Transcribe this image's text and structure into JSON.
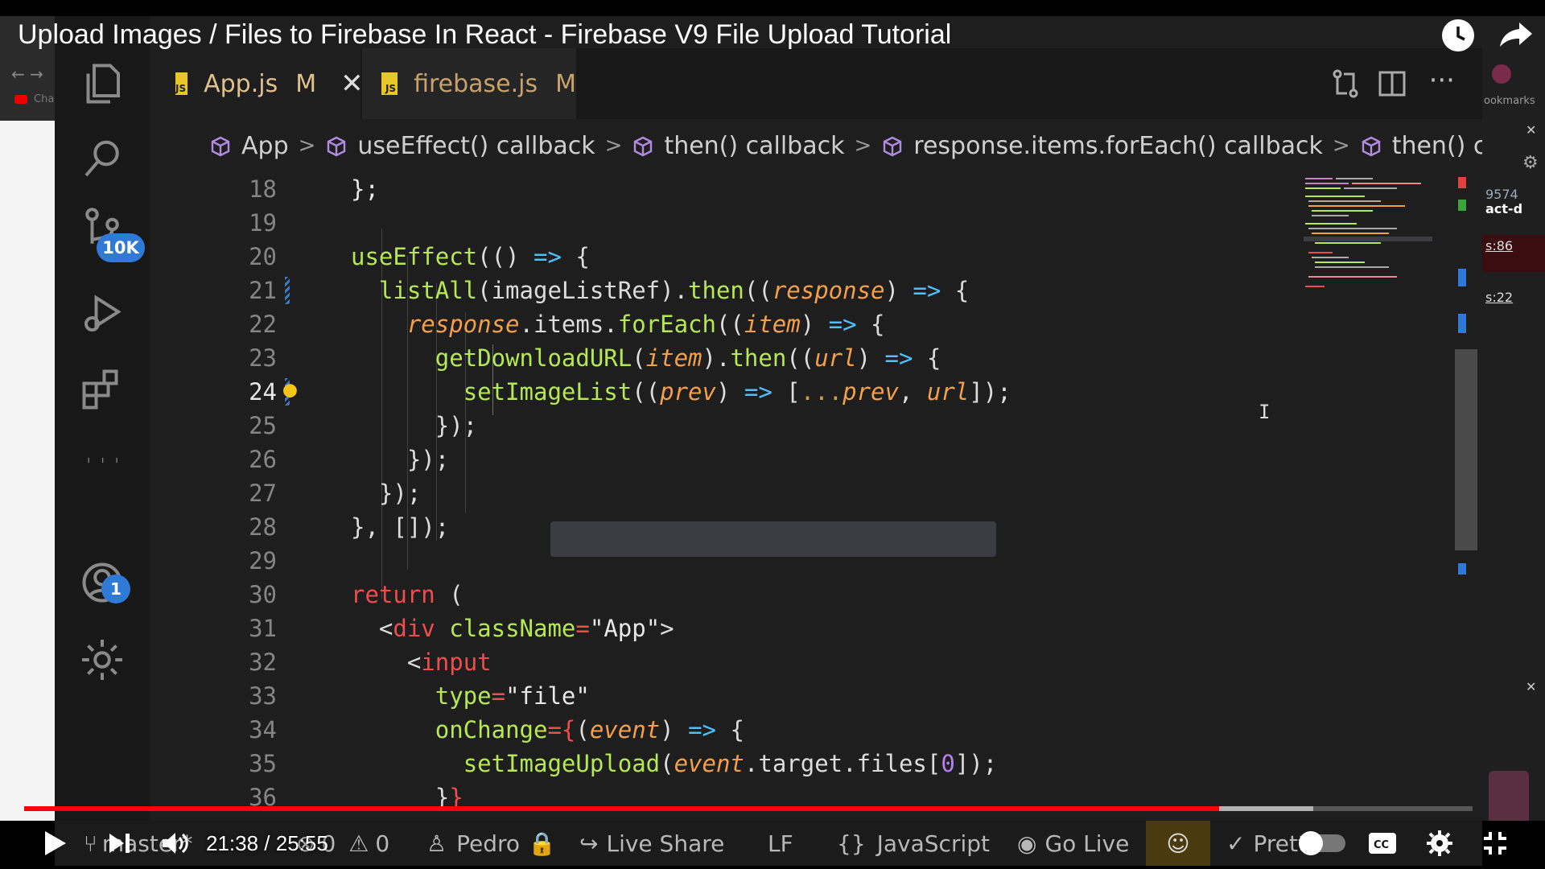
{
  "video": {
    "title": "Upload Images / Files to Firebase In React - Firebase V9 File Upload Tutorial",
    "time_current": "21:38",
    "time_total": "25:55",
    "time_display": "21:38 / 25:55",
    "progress_fraction": 0.825,
    "buffered_fraction": 0.89
  },
  "browser": {
    "tab_text": "Cha",
    "bookmarks_text": "ookmarks"
  },
  "activity_bar": {
    "source_control_badge": "10K",
    "accounts_badge": "1"
  },
  "tabs": [
    {
      "icon": "JS",
      "label": "App.js",
      "status": "M",
      "active": true
    },
    {
      "icon": "JS",
      "label": "firebase.js",
      "status": "M",
      "active": false
    }
  ],
  "breadcrumbs": [
    "App",
    "useEffect() callback",
    "then() callback",
    "response.items.forEach() callback",
    "then() callback"
  ],
  "editor": {
    "active_line": 24,
    "line_numbers": [
      "18",
      "19",
      "20",
      "21",
      "22",
      "23",
      "24",
      "25",
      "26",
      "27",
      "28",
      "29",
      "30",
      "31",
      "32",
      "33",
      "34",
      "35",
      "36"
    ]
  },
  "right_panel": {
    "texts": [
      "9574",
      "act-d",
      "s:86",
      "s:22"
    ]
  },
  "status_bar": {
    "branch": "master*",
    "errors": "0",
    "warnings": "0",
    "user": "Pedro",
    "live_share": "Live Share",
    "eol": "LF",
    "language": "JavaScript",
    "go_live": "Go Live",
    "prettier": "Prettier"
  },
  "colors": {
    "accent_blue": "#2f7ad6",
    "progress_red": "#ff0000",
    "js_yellow": "#e8c72a"
  }
}
